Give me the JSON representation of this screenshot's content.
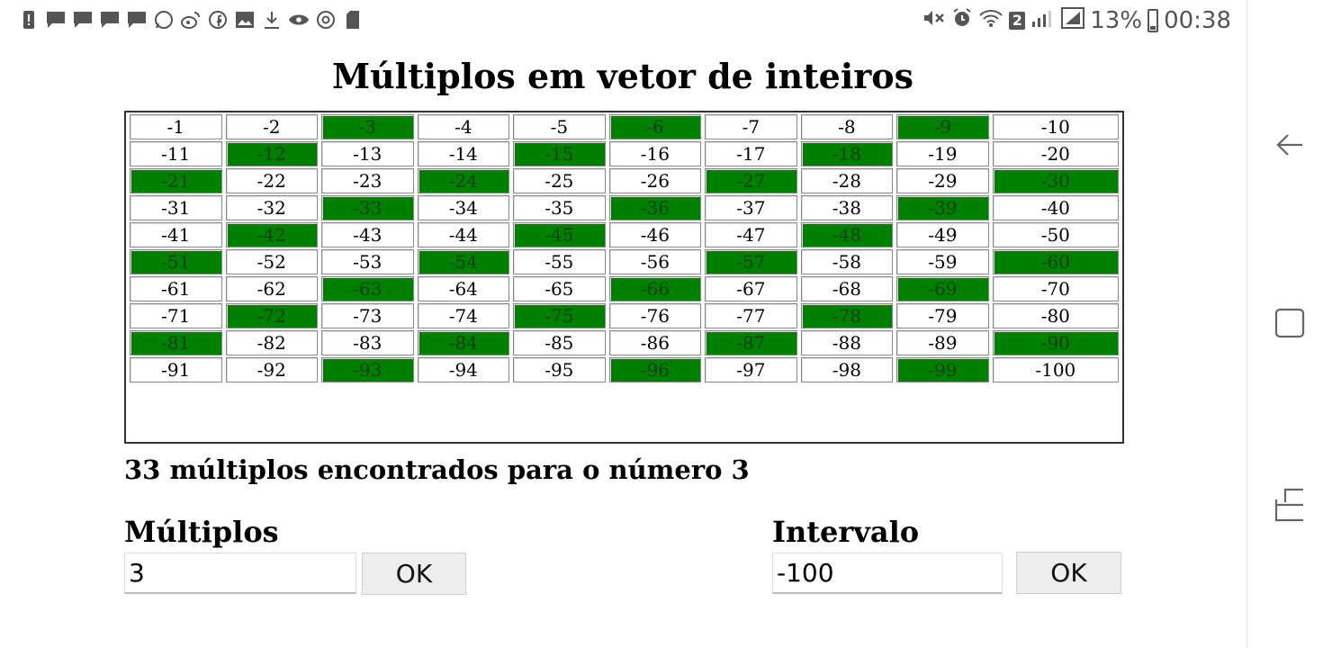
{
  "status_bar": {
    "notification_icons": [
      "alert-icon",
      "message-icon",
      "message-icon",
      "message-icon",
      "message-icon",
      "whatsapp-icon",
      "weibo-icon",
      "facebook-icon",
      "image-icon",
      "download-icon",
      "eye-icon",
      "chrome-icon",
      "sd-card-icon"
    ],
    "battery_percent": "13%",
    "time": "00:38",
    "sim_badge": "2"
  },
  "page": {
    "title": "Múltiplos em vetor de inteiros",
    "result_text": "33 múltiplos encontrados para o número 3",
    "hit_color": "#008000"
  },
  "grid": {
    "columns": 10,
    "cells": [
      {
        "v": "-1",
        "hit": false
      },
      {
        "v": "-2",
        "hit": false
      },
      {
        "v": "-3",
        "hit": true
      },
      {
        "v": "-4",
        "hit": false
      },
      {
        "v": "-5",
        "hit": false
      },
      {
        "v": "-6",
        "hit": true
      },
      {
        "v": "-7",
        "hit": false
      },
      {
        "v": "-8",
        "hit": false
      },
      {
        "v": "-9",
        "hit": true
      },
      {
        "v": "-10",
        "hit": false
      },
      {
        "v": "-11",
        "hit": false
      },
      {
        "v": "-12",
        "hit": true
      },
      {
        "v": "-13",
        "hit": false
      },
      {
        "v": "-14",
        "hit": false
      },
      {
        "v": "-15",
        "hit": true
      },
      {
        "v": "-16",
        "hit": false
      },
      {
        "v": "-17",
        "hit": false
      },
      {
        "v": "-18",
        "hit": true
      },
      {
        "v": "-19",
        "hit": false
      },
      {
        "v": "-20",
        "hit": false
      },
      {
        "v": "-21",
        "hit": true
      },
      {
        "v": "-22",
        "hit": false
      },
      {
        "v": "-23",
        "hit": false
      },
      {
        "v": "-24",
        "hit": true
      },
      {
        "v": "-25",
        "hit": false
      },
      {
        "v": "-26",
        "hit": false
      },
      {
        "v": "-27",
        "hit": true
      },
      {
        "v": "-28",
        "hit": false
      },
      {
        "v": "-29",
        "hit": false
      },
      {
        "v": "-30",
        "hit": true
      },
      {
        "v": "-31",
        "hit": false
      },
      {
        "v": "-32",
        "hit": false
      },
      {
        "v": "-33",
        "hit": true
      },
      {
        "v": "-34",
        "hit": false
      },
      {
        "v": "-35",
        "hit": false
      },
      {
        "v": "-36",
        "hit": true
      },
      {
        "v": "-37",
        "hit": false
      },
      {
        "v": "-38",
        "hit": false
      },
      {
        "v": "-39",
        "hit": true
      },
      {
        "v": "-40",
        "hit": false
      },
      {
        "v": "-41",
        "hit": false
      },
      {
        "v": "-42",
        "hit": true
      },
      {
        "v": "-43",
        "hit": false
      },
      {
        "v": "-44",
        "hit": false
      },
      {
        "v": "-45",
        "hit": true
      },
      {
        "v": "-46",
        "hit": false
      },
      {
        "v": "-47",
        "hit": false
      },
      {
        "v": "-48",
        "hit": true
      },
      {
        "v": "-49",
        "hit": false
      },
      {
        "v": "-50",
        "hit": false
      },
      {
        "v": "-51",
        "hit": true
      },
      {
        "v": "-52",
        "hit": false
      },
      {
        "v": "-53",
        "hit": false
      },
      {
        "v": "-54",
        "hit": true
      },
      {
        "v": "-55",
        "hit": false
      },
      {
        "v": "-56",
        "hit": false
      },
      {
        "v": "-57",
        "hit": true
      },
      {
        "v": "-58",
        "hit": false
      },
      {
        "v": "-59",
        "hit": false
      },
      {
        "v": "-60",
        "hit": true
      },
      {
        "v": "-61",
        "hit": false
      },
      {
        "v": "-62",
        "hit": false
      },
      {
        "v": "-63",
        "hit": true
      },
      {
        "v": "-64",
        "hit": false
      },
      {
        "v": "-65",
        "hit": false
      },
      {
        "v": "-66",
        "hit": true
      },
      {
        "v": "-67",
        "hit": false
      },
      {
        "v": "-68",
        "hit": false
      },
      {
        "v": "-69",
        "hit": true
      },
      {
        "v": "-70",
        "hit": false
      },
      {
        "v": "-71",
        "hit": false
      },
      {
        "v": "-72",
        "hit": true
      },
      {
        "v": "-73",
        "hit": false
      },
      {
        "v": "-74",
        "hit": false
      },
      {
        "v": "-75",
        "hit": true
      },
      {
        "v": "-76",
        "hit": false
      },
      {
        "v": "-77",
        "hit": false
      },
      {
        "v": "-78",
        "hit": true
      },
      {
        "v": "-79",
        "hit": false
      },
      {
        "v": "-80",
        "hit": false
      },
      {
        "v": "-81",
        "hit": true
      },
      {
        "v": "-82",
        "hit": false
      },
      {
        "v": "-83",
        "hit": false
      },
      {
        "v": "-84",
        "hit": true
      },
      {
        "v": "-85",
        "hit": false
      },
      {
        "v": "-86",
        "hit": false
      },
      {
        "v": "-87",
        "hit": true
      },
      {
        "v": "-88",
        "hit": false
      },
      {
        "v": "-89",
        "hit": false
      },
      {
        "v": "-90",
        "hit": true
      },
      {
        "v": "-91",
        "hit": false
      },
      {
        "v": "-92",
        "hit": false
      },
      {
        "v": "-93",
        "hit": true
      },
      {
        "v": "-94",
        "hit": false
      },
      {
        "v": "-95",
        "hit": false
      },
      {
        "v": "-96",
        "hit": true
      },
      {
        "v": "-97",
        "hit": false
      },
      {
        "v": "-98",
        "hit": false
      },
      {
        "v": "-99",
        "hit": true
      },
      {
        "v": "-100",
        "hit": false
      }
    ]
  },
  "multiplos": {
    "label": "Múltiplos",
    "value": "3",
    "button_label": "OK"
  },
  "intervalo": {
    "label": "Intervalo",
    "value": "-100",
    "button_label": "OK"
  },
  "nav_bar": {
    "icons": [
      "back-icon",
      "home-icon",
      "recents-icon"
    ]
  }
}
